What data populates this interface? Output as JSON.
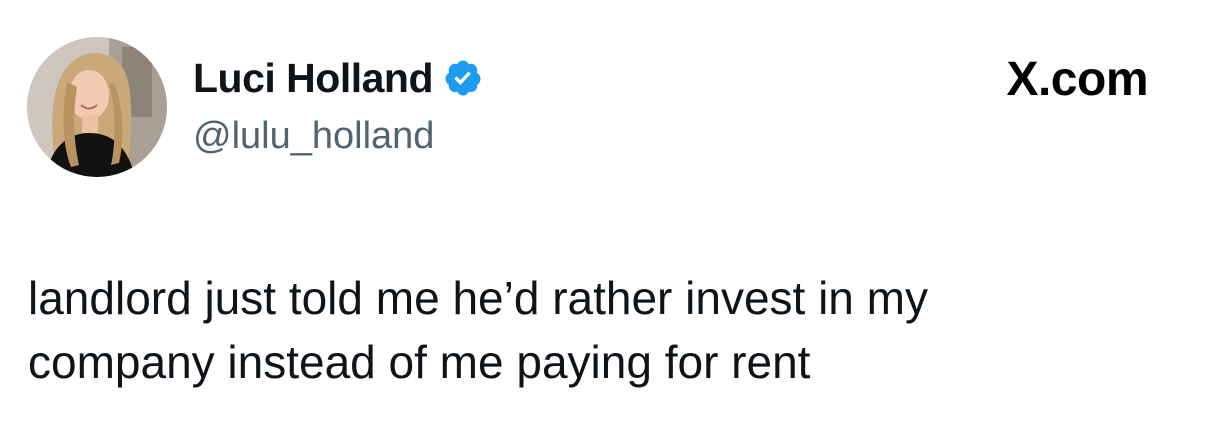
{
  "author": {
    "display_name": "Luci Holland",
    "handle": "@lulu_holland",
    "verified": true,
    "verified_color": "#1d9bf0",
    "avatar_icon": "profile-photo"
  },
  "brand": {
    "label": "X.com"
  },
  "tweet": {
    "lines": [
      "landlord just told me he’d rather invest in my",
      "company instead of me paying for rent"
    ]
  }
}
